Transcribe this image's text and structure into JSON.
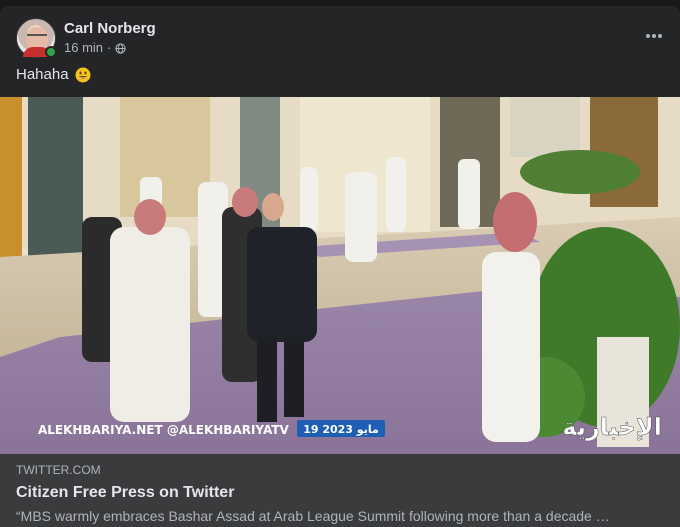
{
  "post": {
    "author": "Carl Norberg",
    "time": "16 min",
    "separator": "·",
    "privacy_icon": "globe-icon",
    "more_icon": "more-options-icon",
    "text": "Hahaha",
    "emoji": "grinning-face-emoji",
    "online": true
  },
  "media": {
    "watermark_left": "ALEKHBARIYA.NET @ALEKHBARIYATV",
    "date_badge": "19 مايو 2023",
    "logo_text": "الإخبارية"
  },
  "link_card": {
    "domain": "TWITTER.COM",
    "title": "Citizen Free Press on Twitter",
    "description": "“MBS warmly embraces Bashar Assad at Arab League Summit following more than a decade …"
  },
  "colors": {
    "post_bg": "#242526",
    "card_bg": "#3a3b3c",
    "online_green": "#31a24c",
    "badge_blue": "#1f5fb3"
  }
}
